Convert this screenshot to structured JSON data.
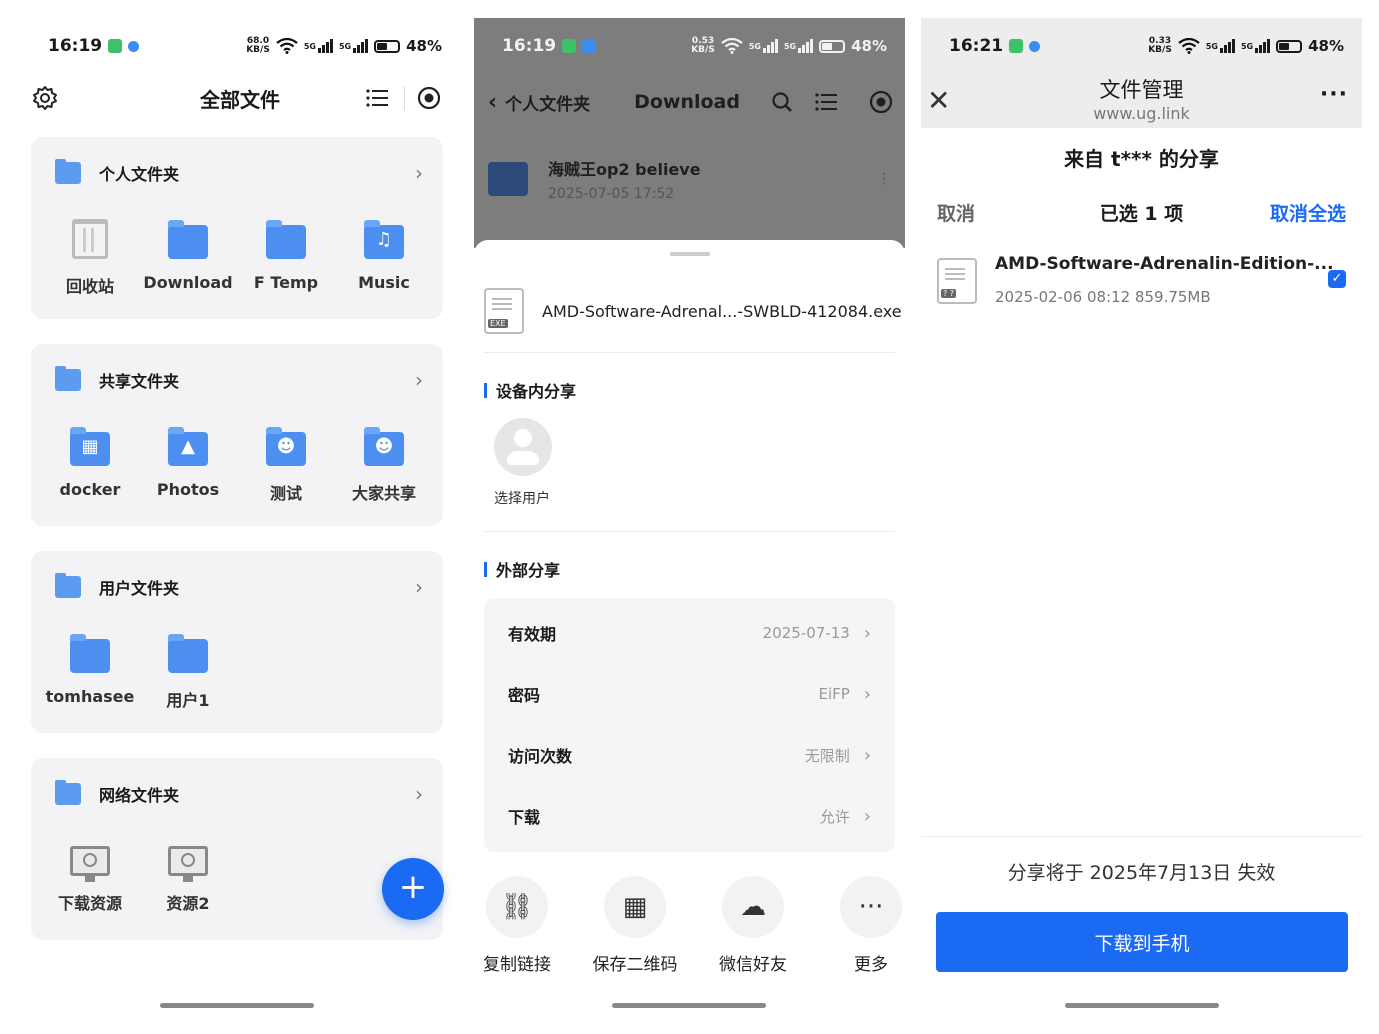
{
  "screen1": {
    "status": {
      "time": "16:19",
      "speed_top": "68.0",
      "speed_bottom": "KB/S",
      "net1": "5G",
      "net2": "5G",
      "battery": "48%"
    },
    "title": "全部文件",
    "cards": {
      "personal": {
        "title": "个人文件夹",
        "items": [
          "回收站",
          "Download",
          "F Temp",
          "Music"
        ]
      },
      "shared": {
        "title": "共享文件夹",
        "items": [
          "docker",
          "Photos",
          "测试",
          "大家共享"
        ]
      },
      "users": {
        "title": "用户文件夹",
        "items": [
          "tomhasee",
          "用户1"
        ]
      },
      "network": {
        "title": "网络文件夹",
        "items": [
          "下载资源",
          "资源2"
        ]
      }
    },
    "fab": "+"
  },
  "screen2": {
    "status": {
      "time": "16:19",
      "speed_top": "0.53",
      "speed_bottom": "KB/S",
      "net1": "5G",
      "net2": "5G",
      "battery": "48%"
    },
    "nav": {
      "back": "个人文件夹",
      "title": "Download"
    },
    "bg_file": {
      "name": "海贼王op2 believe",
      "date": "2025-07-05 17:52"
    },
    "file": {
      "name": "AMD-Software-Adrenal...-SWBLD-412084.exe",
      "tag": "EXE"
    },
    "internal_title": "设备内分享",
    "select_user": "选择用户",
    "external_title": "外部分享",
    "options": [
      {
        "key": "有效期",
        "value": "2025-07-13"
      },
      {
        "key": "密码",
        "value": "EiFP"
      },
      {
        "key": "访问次数",
        "value": "无限制"
      },
      {
        "key": "下载",
        "value": "允许"
      }
    ],
    "actions": [
      "复制链接",
      "保存二维码",
      "微信好友",
      "更多"
    ]
  },
  "screen3": {
    "status": {
      "time": "16:21",
      "speed_top": "0.33",
      "speed_bottom": "KB/S",
      "net1": "5G",
      "net2": "5G",
      "battery": "48%"
    },
    "title": "文件管理",
    "subtitle": "www.ug.link",
    "share_from": "来自 t*** 的分享",
    "cancel": "取消",
    "selected": "已选 1 项",
    "deselect_all": "取消全选",
    "file": {
      "name": "AMD-Software-Adrenalin-Edition-...",
      "meta": "2025-02-06 08:12  859.75MB",
      "tag": "? ?"
    },
    "expire": "分享将于 2025年7月13日 失效",
    "download": "下载到手机"
  },
  "colors": {
    "accent": "#1a6af4",
    "folder": "#4c8ff0",
    "card_bg": "#f3f3f5"
  }
}
